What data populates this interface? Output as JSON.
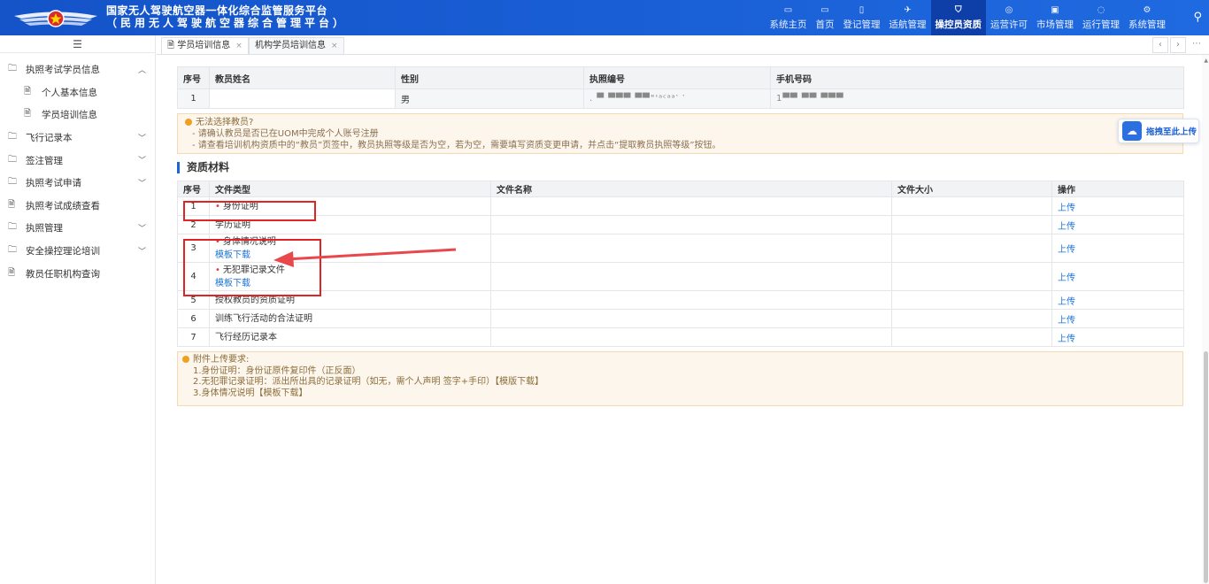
{
  "header": {
    "title_line1": "国家无人驾驶航空器一体化综合监管服务平台",
    "title_line2": "（民用无人驾驶航空器综合管理平台）",
    "nav": [
      {
        "label": "系统主页",
        "icon": "home-icon",
        "glyph": "▭"
      },
      {
        "label": "首页",
        "icon": "monitor-icon",
        "glyph": "▭"
      },
      {
        "label": "登记管理",
        "icon": "file-icon",
        "glyph": "▯"
      },
      {
        "label": "适航管理",
        "icon": "drone-icon",
        "glyph": "✈"
      },
      {
        "label": "操控员资质",
        "icon": "shield-icon",
        "glyph": "⛉"
      },
      {
        "label": "运营许可",
        "icon": "globe-icon",
        "glyph": "◎"
      },
      {
        "label": "市场管理",
        "icon": "store-icon",
        "glyph": "▣"
      },
      {
        "label": "运行管理",
        "icon": "refresh-icon",
        "glyph": "◌"
      },
      {
        "label": "系统管理",
        "icon": "settings-icon",
        "glyph": "⚙"
      }
    ],
    "active_nav": "操控员资质"
  },
  "sidebar": {
    "collapse_icon": "☰",
    "items": [
      {
        "label": "执照考试学员信息",
        "icon": "folder-icon",
        "expanded": true
      },
      {
        "label": "个人基本信息",
        "icon": "doc-icon",
        "sub": true
      },
      {
        "label": "学员培训信息",
        "icon": "doc-icon",
        "sub": true
      },
      {
        "label": "飞行记录本",
        "icon": "folder-icon",
        "expandable": true
      },
      {
        "label": "签注管理",
        "icon": "folder-icon",
        "expandable": true
      },
      {
        "label": "执照考试申请",
        "icon": "folder-icon",
        "expandable": true
      },
      {
        "label": "执照考试成绩查看",
        "icon": "doc-icon"
      },
      {
        "label": "执照管理",
        "icon": "folder-icon",
        "expandable": true
      },
      {
        "label": "安全操控理论培训",
        "icon": "folder-icon",
        "expandable": true
      },
      {
        "label": "教员任职机构查询",
        "icon": "doc-icon"
      }
    ]
  },
  "tabs": [
    {
      "label": "学员培训信息",
      "close": "×"
    },
    {
      "label": "机构学员培训信息",
      "close": "×"
    }
  ],
  "teacher_table": {
    "headers": [
      "序号",
      "教员姓名",
      "性别",
      "执照编号",
      "手机号码"
    ],
    "rows": [
      {
        "idx": "1",
        "name": "",
        "gender": "男",
        "license": ".  ▀  ▀▀▀ ▀▀\"'ᵃᶜᵃᵃ‵  ‵",
        "phone": "1▀▀  ▀▀  ▀▀▀"
      }
    ]
  },
  "notice": {
    "title": "无法选择教员?",
    "lines": [
      "- 请确认教员是否已在UOM中完成个人账号注册",
      "- 请查看培训机构资质中的“教员”页签中，教员执照等级是否为空，若为空，需要填写资质变更申请，并点击“提取教员执照等级”按钮。"
    ]
  },
  "section_title": "资质材料",
  "files_table": {
    "headers": [
      "序号",
      "文件类型",
      "文件名称",
      "文件大小",
      "操作"
    ],
    "rows": [
      {
        "idx": "1",
        "type": "身份证明",
        "required": true,
        "template": "",
        "name": "",
        "size": "",
        "action": "上传"
      },
      {
        "idx": "2",
        "type": "学历证明",
        "required": false,
        "template": "",
        "name": "",
        "size": "",
        "action": "上传"
      },
      {
        "idx": "3",
        "type": "身体情况说明",
        "required": true,
        "template": "模板下载",
        "name": "",
        "size": "",
        "action": "上传"
      },
      {
        "idx": "4",
        "type": "无犯罪记录文件",
        "required": true,
        "template": "模板下载",
        "name": "",
        "size": "",
        "action": "上传"
      },
      {
        "idx": "5",
        "type": "授权教员的资质证明",
        "required": false,
        "template": "",
        "name": "",
        "size": "",
        "action": "上传"
      },
      {
        "idx": "6",
        "type": "训练飞行活动的合法证明",
        "required": false,
        "template": "",
        "name": "",
        "size": "",
        "action": "上传"
      },
      {
        "idx": "7",
        "type": "飞行经历记录本",
        "required": false,
        "template": "",
        "name": "",
        "size": "",
        "action": "上传"
      }
    ]
  },
  "attach": {
    "title": "附件上传要求:",
    "lines": [
      "1.身份证明：身份证原件复印件（正反面）",
      "2.无犯罪记录证明：派出所出具的记录证明（如无，需个人声明 签字+手印）【模版下载】",
      "3.身体情况说明【模板下载】"
    ]
  },
  "float_upload": {
    "label": "拖拽至此上传",
    "icon": "cloud-upload-icon"
  },
  "colors": {
    "header": "#1a5fd6",
    "active_nav": "#0e3fa8",
    "link": "#1a73d9",
    "annotation": "#e02424",
    "notice_bg": "#fdf6ec"
  }
}
